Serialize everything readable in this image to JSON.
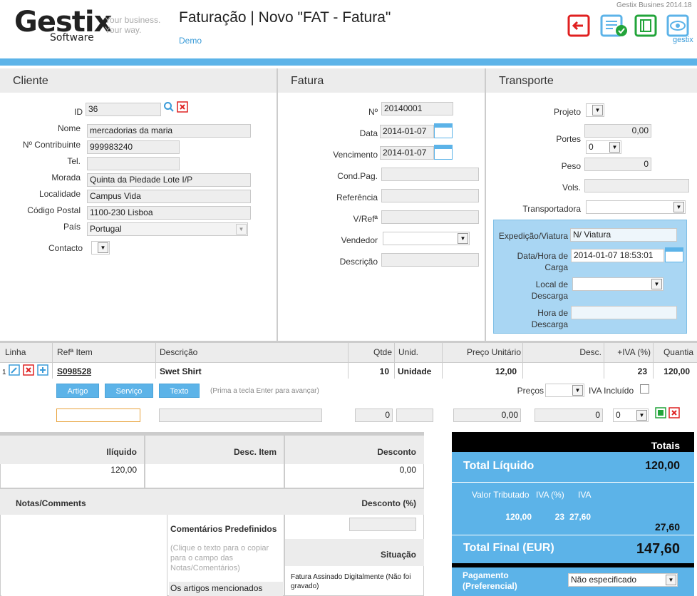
{
  "header": {
    "logo_main": "Gestix",
    "logo_sub": "Software",
    "logo_tag1": "Your business.",
    "logo_tag2": "Your way.",
    "title": "Faturação | Novo \"FAT - Fatura\"",
    "demo_link": "Demo",
    "version": "Gestix Busines 2014.18",
    "user_link": "gestix",
    "colors": {
      "exit": "#e02020",
      "save_check": "#5cb3e8",
      "book": "#22a43a",
      "eye": "#5cb3e8"
    }
  },
  "cliente": {
    "title": "Cliente",
    "id_label": "ID",
    "id_value": "36",
    "nome_label": "Nome",
    "nome_value": "mercadorias da maria",
    "nif_label": "Nº Contribuinte",
    "nif_value": "999983240",
    "tel_label": "Tel.",
    "tel_value": "",
    "morada_label": "Morada",
    "morada_value": "Quinta da Piedade Lote I/P",
    "localidade_label": "Localidade",
    "localidade_value": "Campus Vida",
    "cp_label": "Código Postal",
    "cp_value": "1100-230 Lisboa",
    "pais_label": "País",
    "pais_value": "Portugal",
    "contacto_label": "Contacto"
  },
  "fatura": {
    "title": "Fatura",
    "num_label": "Nº",
    "num_value": "20140001",
    "data_label": "Data",
    "data_value": "2014-01-07",
    "venc_label": "Vencimento",
    "venc_value": "2014-01-07",
    "condpag_label": "Cond.Pag.",
    "ref_label": "Referência",
    "vref_label": "V/Refª",
    "vendedor_label": "Vendedor",
    "descricao_label": "Descrição"
  },
  "transporte": {
    "title": "Transporte",
    "projeto_label": "Projeto",
    "portes_label": "Portes",
    "portes_value": "0,00",
    "portes_sel": "0",
    "peso_label": "Peso",
    "peso_value": "0",
    "vols_label": "Vols.",
    "transportadora_label": "Transportadora",
    "expedicao_label": "Expedição/Viatura",
    "expedicao_value": "N/ Viatura",
    "carga_label1": "Data/Hora de",
    "carga_label2": "Carga",
    "carga_value": "2014-01-07 18:53:01",
    "local_label1": "Local de",
    "local_label2": "Descarga",
    "hora_label1": "Hora de",
    "hora_label2": "Descarga"
  },
  "lines": {
    "headers": [
      "Linha",
      "Refª Item",
      "Descrição",
      "Qtde",
      "Unid.",
      "Preço Unitário",
      "Desc.",
      "+IVA (%)",
      "Quantia"
    ],
    "row": {
      "num": "1",
      "ref": "S098528",
      "desc": "Swet Shirt",
      "qtde": "10",
      "unid": "Unidade",
      "preco": "12,00",
      "descv": "",
      "iva": "23",
      "quantia": "120,00"
    },
    "btn_artigo": "Artigo",
    "btn_servico": "Serviço",
    "btn_texto": "Texto",
    "hint": "(Prima a tecla Enter para avançar)",
    "precos_label": "Preços",
    "iva_incl_label": "IVA Incluído",
    "new_qtde": "0",
    "new_preco": "0,00",
    "new_desc": "0",
    "new_iva": "0"
  },
  "summary": {
    "iliquido_label": "Ilíquido",
    "iliquido_value": "120,00",
    "descitem_label": "Desc. Item",
    "desconto_label": "Desconto",
    "desconto_value": "0,00",
    "notas_label": "Notas/Comments",
    "desconto_pct_label": "Desconto (%)",
    "coment_pred_label": "Comentários Predefinidos",
    "coment_hint": "(Clique o texto para o copiar para o campo das Notas/Comentários)",
    "coment_item": "Os artigos mencionados",
    "situacao_label": "Situação",
    "situacao_value": "Fatura Assinado Digitalmente (Não foi gravado)"
  },
  "totals": {
    "header": "Totais",
    "liquido_label": "Total Líquido",
    "liquido_value": "120,00",
    "tax_hdr_valor": "Valor Tributado",
    "tax_hdr_pct": "IVA (%)",
    "tax_hdr_iva": "IVA",
    "tax_valor": "120,00",
    "tax_pct": "23",
    "tax_iva": "27,60",
    "iva_total": "27,60",
    "final_label": "Total Final (EUR)",
    "final_value": "147,60",
    "pag_label1": "Pagamento",
    "pag_label2": "(Preferencial)",
    "pag_value": "Não especificado"
  }
}
